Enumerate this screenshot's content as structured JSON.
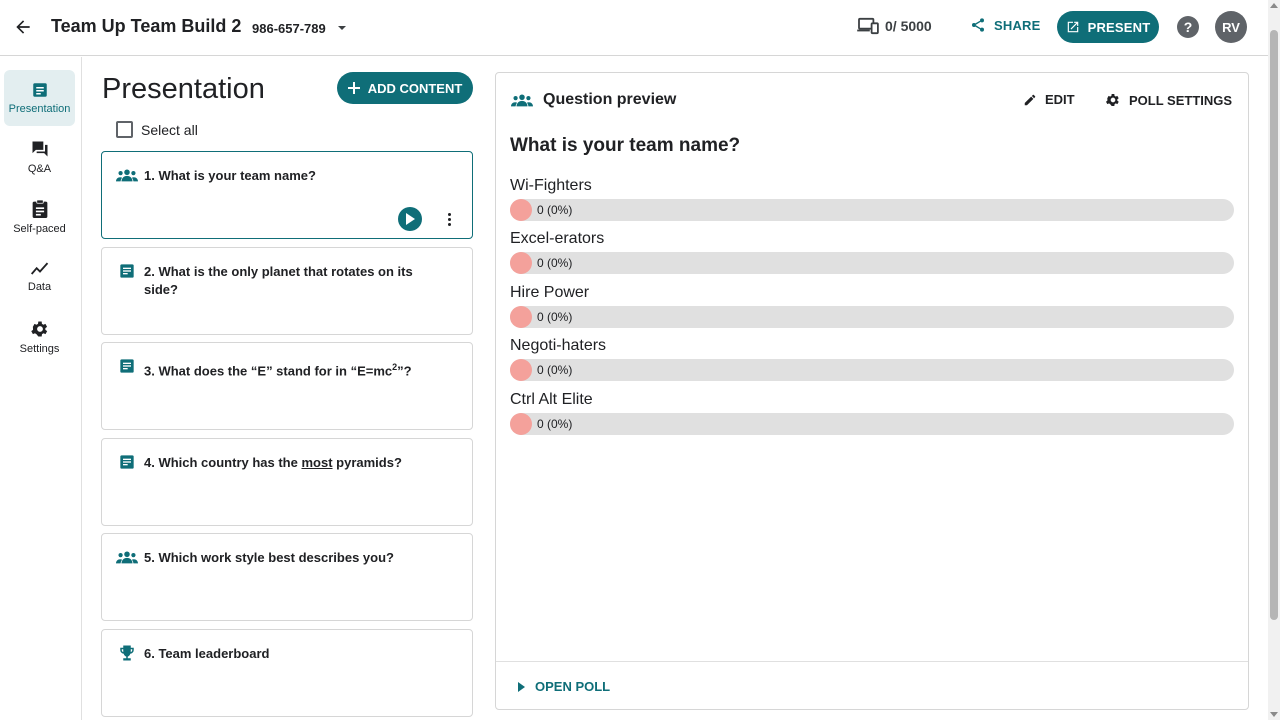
{
  "header": {
    "title": "Team Up Team Build 2",
    "event_code": "986-657-789",
    "participants": "0/ 5000",
    "share_label": "SHARE",
    "present_label": "PRESENT",
    "help_label": "?",
    "avatar_initials": "RV"
  },
  "sidebar": {
    "items": [
      {
        "label": "Presentation",
        "icon": "presentation-icon",
        "active": true
      },
      {
        "label": "Q&A",
        "icon": "qa-icon",
        "active": false
      },
      {
        "label": "Self-paced",
        "icon": "self-paced-icon",
        "active": false
      },
      {
        "label": "Data",
        "icon": "data-icon",
        "active": false
      },
      {
        "label": "Settings",
        "icon": "gear-icon",
        "active": false
      }
    ]
  },
  "presentation": {
    "title": "Presentation",
    "add_content_label": "ADD CONTENT",
    "select_all_label": "Select all",
    "questions": [
      {
        "text": "1. What is your team name?",
        "icon": "team-icon",
        "selected": true
      },
      {
        "text": "2. What is the only planet that rotates on its side?",
        "icon": "text-question-icon"
      },
      {
        "text_before": "3. What does the “E” stand for in “E=mc",
        "sup": "2",
        "text_after": "”?",
        "icon": "text-question-icon"
      },
      {
        "text_before": "4. Which country has the ",
        "emphasis": "most",
        "text_after": " pyramids?",
        "icon": "text-question-icon"
      },
      {
        "text": "5. Which work style best describes you?",
        "icon": "team-icon"
      },
      {
        "text": "6. Team leaderboard",
        "icon": "trophy-icon"
      }
    ]
  },
  "preview": {
    "title": "Question preview",
    "edit_label": "EDIT",
    "poll_settings_label": "POLL SETTINGS",
    "question": "What is your team name?",
    "options": [
      {
        "label": "Wi-Fighters",
        "count_text": "0 (0%)",
        "percent": 0
      },
      {
        "label": "Excel-erators",
        "count_text": "0 (0%)",
        "percent": 0
      },
      {
        "label": "Hire Power",
        "count_text": "0 (0%)",
        "percent": 0
      },
      {
        "label": "Negoti-haters",
        "count_text": "0 (0%)",
        "percent": 0
      },
      {
        "label": "Ctrl Alt Elite",
        "count_text": "0 (0%)",
        "percent": 0
      }
    ],
    "open_poll_label": "OPEN POLL"
  },
  "colors": {
    "accent": "#0f6e78",
    "bar_track": "#e0e0e0",
    "bar_dot": "#f4a19b"
  }
}
